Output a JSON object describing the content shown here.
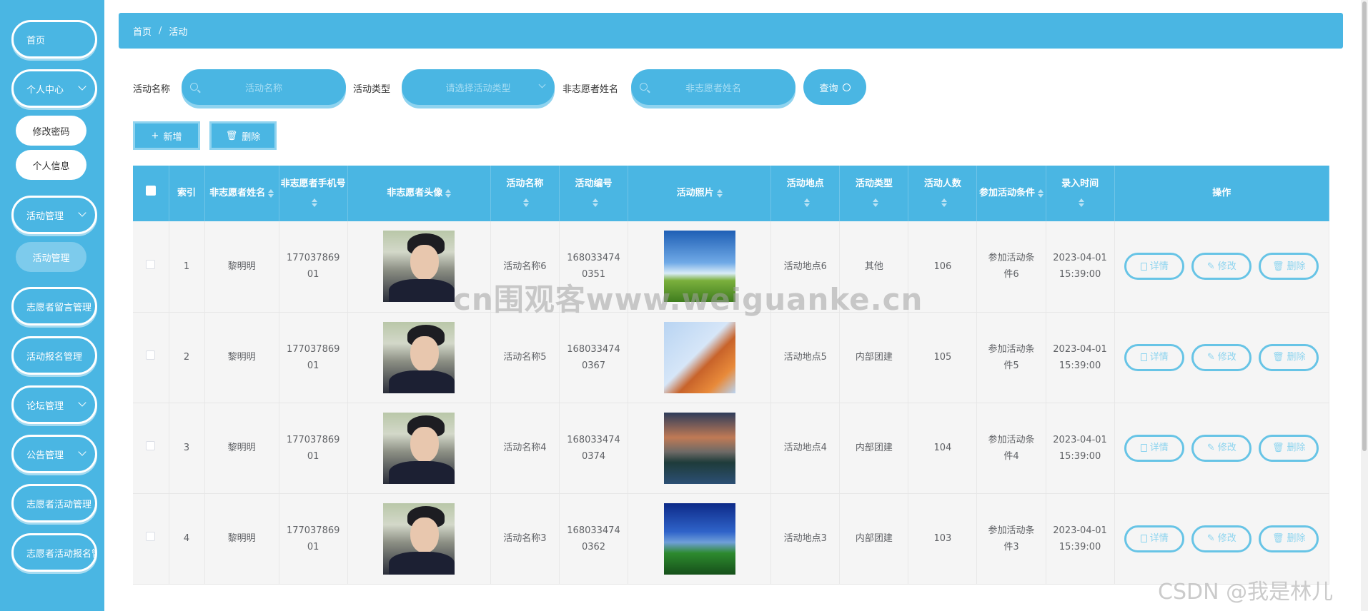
{
  "sidebar": {
    "home": "首页",
    "personal_center": "个人中心",
    "change_password": "修改密码",
    "personal_info": "个人信息",
    "activity_mgmt": "活动管理",
    "activity": "活动管理",
    "volunteer_msg_mgmt": "志愿者留言管理",
    "activity_signup_mgmt": "活动报名管理",
    "forum_mgmt": "论坛管理",
    "notice_mgmt": "公告管理",
    "volunteer_activity_mgmt": "志愿者活动管理",
    "volunteer_activity_signup_mgmt": "志愿者活动报名管"
  },
  "breadcrumb": {
    "home": "首页",
    "separator": "/",
    "current": "活动"
  },
  "search": {
    "name_label": "活动名称",
    "name_placeholder": "活动名称",
    "type_label": "活动类型",
    "type_placeholder": "请选择活动类型",
    "person_label": "非志愿者姓名",
    "person_placeholder": "非志愿者姓名",
    "query": "查询"
  },
  "actions": {
    "add": "新增",
    "delete": "删除"
  },
  "table": {
    "headers": [
      "索引",
      "非志愿者姓名",
      "非志愿者手机号",
      "非志愿者头像",
      "活动名称",
      "活动编号",
      "活动照片",
      "活动地点",
      "活动类型",
      "活动人数",
      "参加活动条件",
      "录入时间",
      "操作"
    ],
    "rows": [
      {
        "index": "1",
        "name": "黎明明",
        "phone": "17703786901",
        "activity": "活动名称6",
        "code": "1680334740351",
        "place": "活动地点6",
        "type": "其他",
        "count": "106",
        "cond": "参加活动条件6",
        "time": "2023-04-01 15:39:00"
      },
      {
        "index": "2",
        "name": "黎明明",
        "phone": "17703786901",
        "activity": "活动名称5",
        "code": "1680334740367",
        "place": "活动地点5",
        "type": "内部团建",
        "count": "105",
        "cond": "参加活动条件5",
        "time": "2023-04-01 15:39:00"
      },
      {
        "index": "3",
        "name": "黎明明",
        "phone": "17703786901",
        "activity": "活动名称4",
        "code": "1680334740374",
        "place": "活动地点4",
        "type": "内部团建",
        "count": "104",
        "cond": "参加活动条件4",
        "time": "2023-04-01 15:39:00"
      },
      {
        "index": "4",
        "name": "黎明明",
        "phone": "17703786901",
        "activity": "活动名称3",
        "code": "1680334740362",
        "place": "活动地点3",
        "type": "内部团建",
        "count": "103",
        "cond": "参加活动条件3",
        "time": "2023-04-01 15:39:00"
      }
    ],
    "ops": {
      "detail": "详情",
      "edit": "修改",
      "delete": "删除"
    }
  },
  "watermark": "cn围观客www.weiguanke.cn",
  "csdn": "CSDN @我是林儿",
  "colors": {
    "primary": "#4ab6e3",
    "light": "#8fd3ef"
  }
}
